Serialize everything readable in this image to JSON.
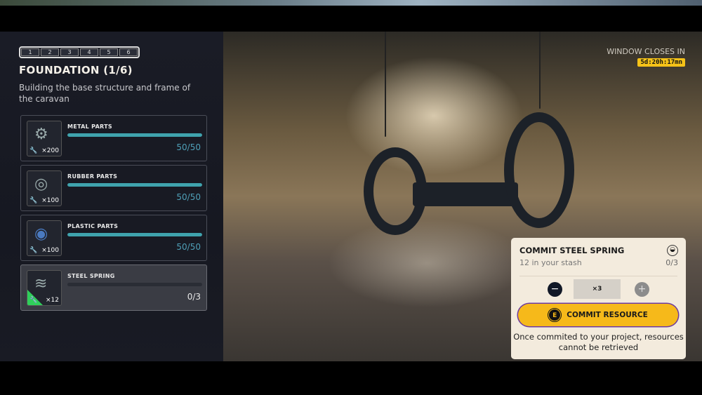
{
  "steps": [
    "1",
    "2",
    "3",
    "4",
    "5",
    "6"
  ],
  "stage": {
    "title": "FOUNDATION (1/6)",
    "description": "Building the base structure and frame of the caravan"
  },
  "resources": [
    {
      "name": "METAL PARTS",
      "quantity": "×200",
      "progress": "50/50",
      "fraction": 1.0,
      "icon": "metal-parts-icon"
    },
    {
      "name": "RUBBER PARTS",
      "quantity": "×100",
      "progress": "50/50",
      "fraction": 1.0,
      "icon": "rubber-parts-icon"
    },
    {
      "name": "PLASTIC PARTS",
      "quantity": "×100",
      "progress": "50/50",
      "fraction": 1.0,
      "icon": "plastic-parts-icon"
    },
    {
      "name": "STEEL SPRING",
      "quantity": "×12",
      "progress": "0/3",
      "fraction": 0.0,
      "icon": "steel-spring-icon",
      "selected": true
    }
  ],
  "window": {
    "label": "WINDOW CLOSES IN",
    "timer": "5d:20h:17mn"
  },
  "commit_panel": {
    "title": "COMMIT STEEL SPRING",
    "stash": "12 in your stash",
    "count": "0/3",
    "amount": "×3",
    "minus": "−",
    "plus": "+",
    "key": "E",
    "button": "COMMIT RESOURCE",
    "note": "Once commited to your project, resources cannot be retrieved"
  },
  "colors": {
    "accent": "#f6b91a",
    "bar": "#3fa3ad",
    "panel": "#f3ebdd"
  }
}
